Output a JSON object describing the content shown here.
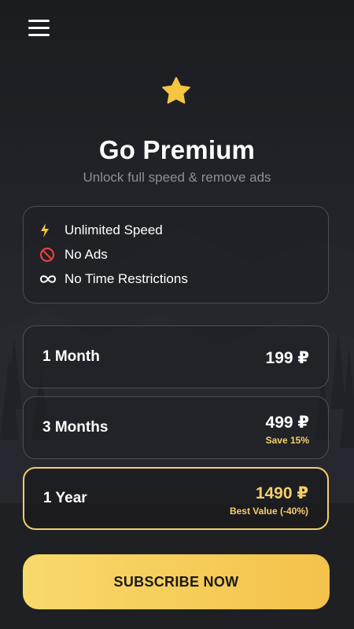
{
  "header": {
    "menu_icon": "hamburger-menu-icon"
  },
  "hero": {
    "icon": "star-icon",
    "title": "Go Premium",
    "subtitle": "Unlock full speed & remove ads"
  },
  "features": [
    {
      "icon": "lightning-icon",
      "label": "Unlimited Speed"
    },
    {
      "icon": "no-entry-icon",
      "label": "No Ads"
    },
    {
      "icon": "infinity-icon",
      "label": "No Time Restrictions"
    }
  ],
  "plans": [
    {
      "name": "1 Month",
      "price": "199 ₽",
      "note": "",
      "selected": false
    },
    {
      "name": "3 Months",
      "price": "499 ₽",
      "note": "Save 15%",
      "selected": false
    },
    {
      "name": "1 Year",
      "price": "1490 ₽",
      "note": "Best Value (-40%)",
      "selected": true
    }
  ],
  "cta": {
    "label": "SUBSCRIBE NOW"
  },
  "colors": {
    "accent": "#f4cf6a",
    "background": "#1f2025",
    "star": "#f5c542"
  }
}
